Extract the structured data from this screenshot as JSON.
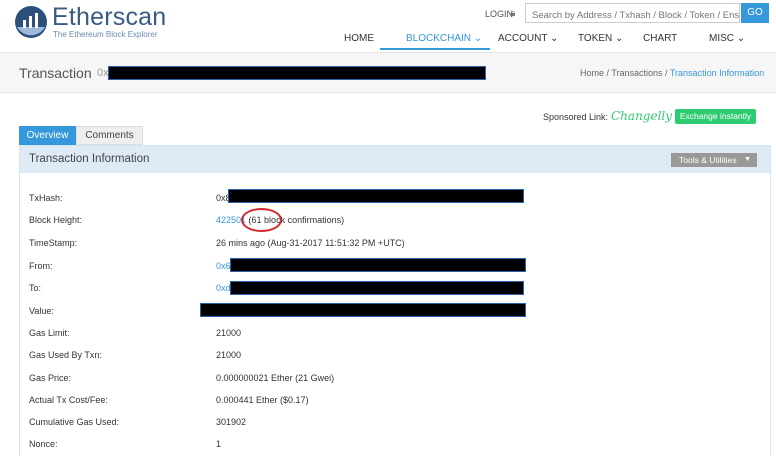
{
  "header": {
    "brand_name": "Etherscan",
    "brand_tagline": "The Ethereum Block Explorer",
    "login_label": "LOGIN",
    "search_placeholder": "Search by Address / Txhash / Block / Token / Ens",
    "go_label": "GO",
    "nav": [
      {
        "label": "HOME"
      },
      {
        "label": "BLOCKCHAIN ⌄"
      },
      {
        "label": "ACCOUNT ⌄"
      },
      {
        "label": "TOKEN ⌄"
      },
      {
        "label": "CHART"
      },
      {
        "label": "MISC ⌄"
      }
    ],
    "active_nav": "BLOCKCHAIN",
    "accent_color": "#3498db"
  },
  "title_bar": {
    "title": "Transaction",
    "hash_prefix": "0x",
    "breadcrumb": {
      "home": "Home",
      "sep1": " / ",
      "transactions": "Transactions",
      "sep2": " / ",
      "current": "Transaction Information"
    }
  },
  "sponsored": {
    "label": "Sponsored Link:",
    "sponsor": "Changelly",
    "button": "Exchange instantly"
  },
  "tabs": [
    {
      "label": "Overview",
      "active": true
    },
    {
      "label": "Comments",
      "active": false
    }
  ],
  "panel": {
    "title": "Transaction Information",
    "tools_label": "Tools & Utilities"
  },
  "rows": {
    "txhash": {
      "label": "TxHash:",
      "value_prefix": "0x8"
    },
    "block_height": {
      "label": "Block Height:",
      "block": "422501",
      "confirmations": " (61 block confirmations)"
    },
    "timestamp": {
      "label": "TimeStamp:",
      "value": "26 mins ago (Aug-31-2017 11:51:32 PM +UTC)"
    },
    "from": {
      "label": "From:",
      "value_prefix": "0x6"
    },
    "to": {
      "label": "To:",
      "value_prefix": "0xd"
    },
    "value": {
      "label": "Value:"
    },
    "gas_limit": {
      "label": "Gas Limit:",
      "value": "21000"
    },
    "gas_used": {
      "label": "Gas Used By Txn:",
      "value": "21000"
    },
    "gas_price": {
      "label": "Gas Price:",
      "value": "0.000000021 Ether (21 Gwei)"
    },
    "tx_fee": {
      "label": "Actual Tx Cost/Fee:",
      "value": "0.000441 Ether ($0.17)"
    },
    "cumulative_gas": {
      "label": "Cumulative Gas Used:",
      "value": "301902"
    },
    "nonce": {
      "label": "Nonce:",
      "value": "1"
    }
  }
}
